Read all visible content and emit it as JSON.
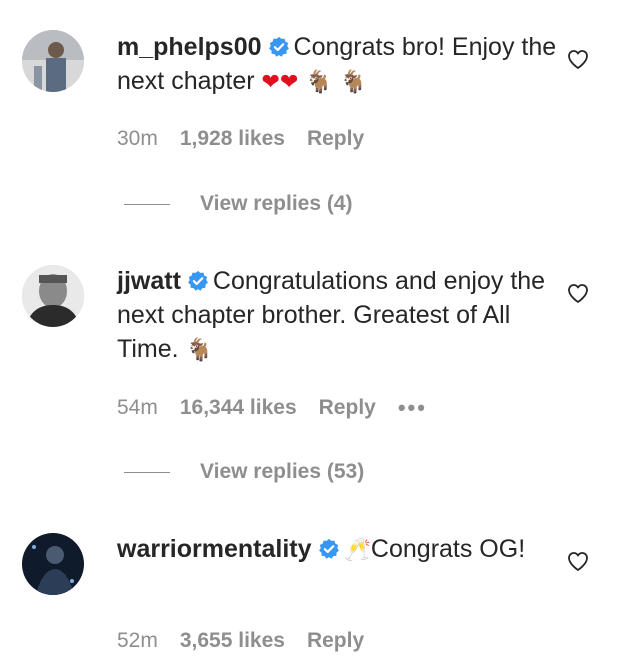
{
  "comments": [
    {
      "username": "m_phelps00",
      "verified": true,
      "text": "Congrats bro! Enjoy the next chapter",
      "emojis": [
        "heart",
        "heart",
        "goat",
        "goat"
      ],
      "time": "30m",
      "likes": "1,928 likes",
      "reply_label": "Reply",
      "view_replies": "View replies (4)"
    },
    {
      "username": "jjwatt",
      "verified": true,
      "text": "Congratulations and enjoy the next chapter brother. Greatest of All Time.",
      "emojis": [
        "goat"
      ],
      "time": "54m",
      "likes": "16,344 likes",
      "reply_label": "Reply",
      "more_label": "•••",
      "view_replies": "View replies (53)"
    },
    {
      "username": "warriormentality",
      "verified": true,
      "leading_emoji": "champagne",
      "text": "Congrats OG!",
      "time": "52m",
      "likes": "3,655 likes",
      "reply_label": "Reply"
    }
  ],
  "glyphs": {
    "heart": "❤",
    "goat": "🐐",
    "champagne": "🥂"
  },
  "colors": {
    "verified_blue": "#3897f0",
    "meta_gray": "#8e8e8e",
    "text": "#262626"
  }
}
